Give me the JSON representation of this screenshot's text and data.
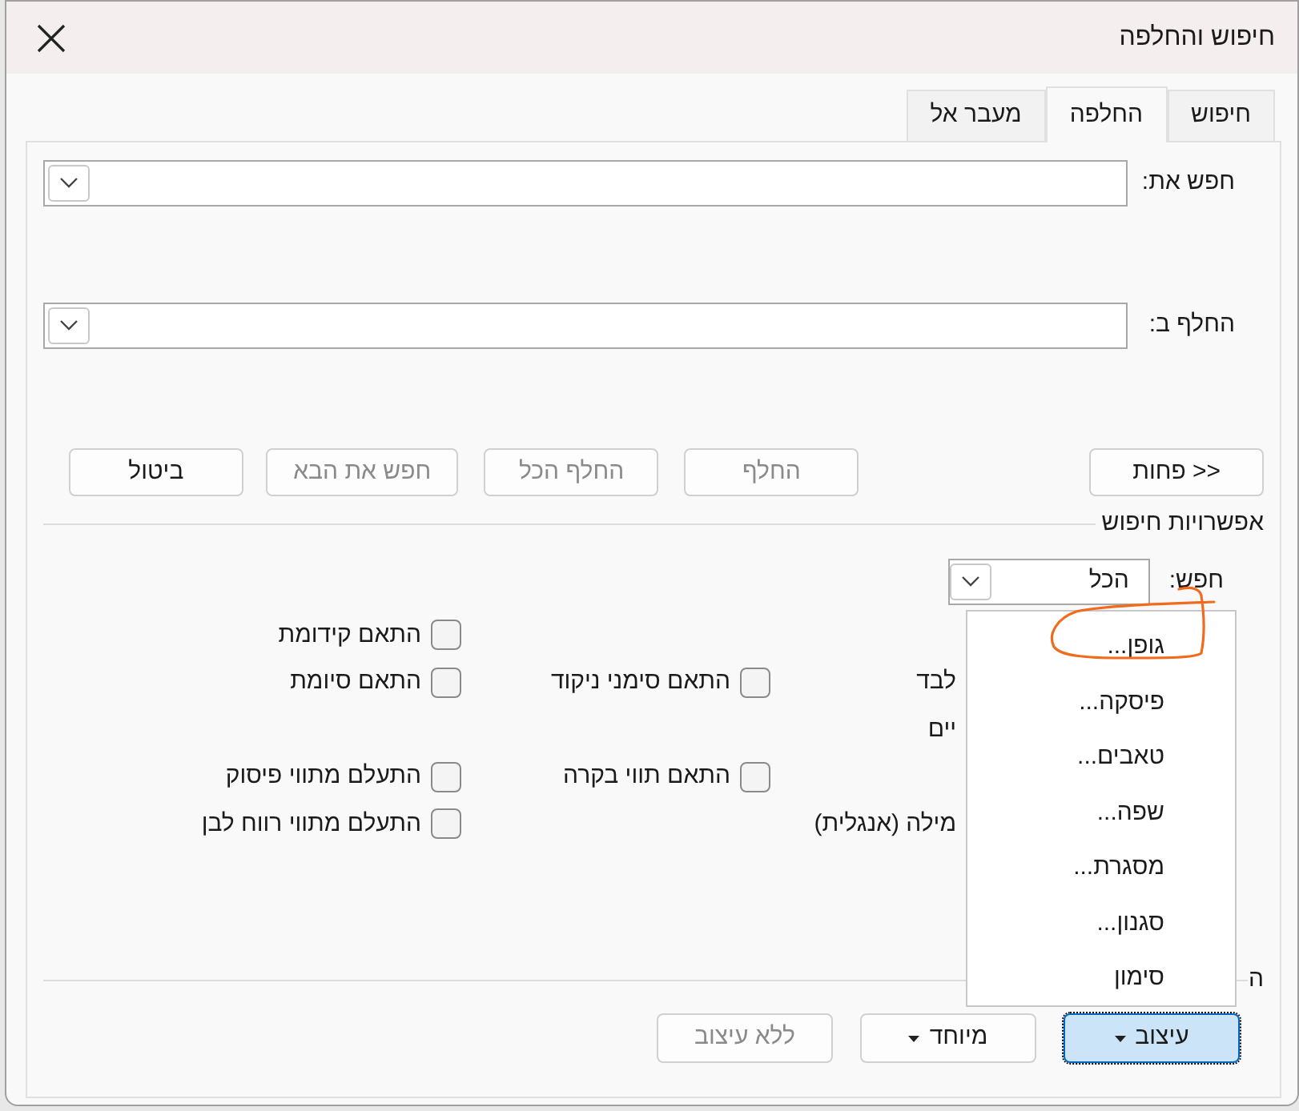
{
  "window": {
    "title": "חיפוש והחלפה"
  },
  "tabs": [
    {
      "label": "חיפוש",
      "selected": false
    },
    {
      "label": "החלפה",
      "selected": true
    },
    {
      "label": "מעבר אל",
      "selected": false
    }
  ],
  "find_what": {
    "label": "חפש את:"
  },
  "replace_with": {
    "label": "החלף ב:"
  },
  "buttons": [
    {
      "label": "<< פחות",
      "disabled": false
    },
    {
      "label": "החלף",
      "disabled": true
    },
    {
      "label": "החלף הכל",
      "disabled": true
    },
    {
      "label": "חפש את הבא",
      "disabled": true
    },
    {
      "label": "ביטול",
      "disabled": false
    }
  ],
  "search_options": {
    "title": "אפשרויות חיפוש",
    "search_label": "חפש:",
    "search_value": "הכל",
    "rows": [
      [
        null,
        null,
        {
          "label": "התאם קידומת",
          "checked": false
        }
      ],
      [
        {
          "text": "לבד"
        },
        {
          "label": "התאם סימני ניקוד",
          "checked": false
        },
        {
          "label": "התאם סיומת",
          "checked": false
        }
      ],
      [
        {
          "text": "יים"
        },
        null,
        null
      ],
      [
        null,
        {
          "label": "התאם תווי בקרה",
          "checked": false
        },
        {
          "label": "התעלם מתווי פיסוק",
          "checked": false
        }
      ],
      [
        {
          "text": "מילה (אנגלית)"
        },
        null,
        {
          "label": "התעלם מתווי רווח לבן",
          "checked": false
        }
      ]
    ]
  },
  "replace_section": {
    "title": "ה"
  },
  "bottom_buttons": [
    {
      "label": "עיצוב",
      "kind": "dropdown",
      "pressed": true,
      "disabled": false
    },
    {
      "label": "מיוחד",
      "kind": "dropdown",
      "pressed": false,
      "disabled": false
    },
    {
      "label": "ללא עיצוב",
      "kind": "plain",
      "pressed": false,
      "disabled": true
    }
  ],
  "format_menu": {
    "items": [
      "גופן...",
      "פיסקה...",
      "טאבים...",
      "שפה...",
      "מסגרת...",
      "סגנון...",
      "סימון"
    ]
  }
}
